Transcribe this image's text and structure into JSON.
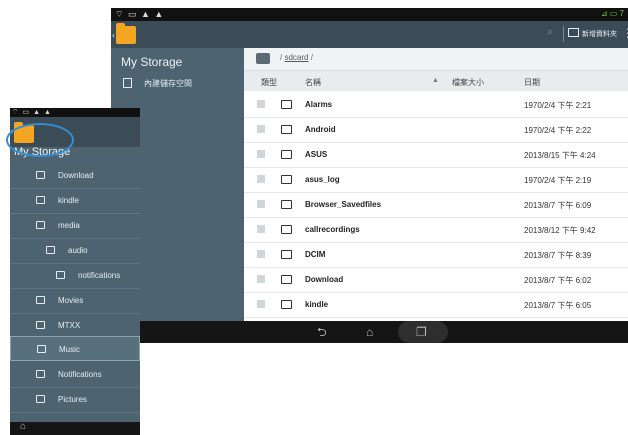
{
  "tablet": {
    "status_left": "⌔ ▭ ▲ ▲",
    "status_right": "⊿ ▭ 7",
    "actionbar": {
      "new_folder_label": "新增資料夾",
      "menu_icon": "⋮"
    },
    "sidebar": {
      "title": "My Storage",
      "items": [
        {
          "label": "內建儲存空間"
        }
      ]
    },
    "breadcrumb": {
      "root": "/",
      "path": "sdcard",
      "trail": "/"
    },
    "table": {
      "headers": {
        "type": "類型",
        "name": "名稱",
        "sort": "▲",
        "size": "檔案大小",
        "date": "日期"
      },
      "rows": [
        {
          "name": "Alarms",
          "date": "1970/2/4 下午 2:21"
        },
        {
          "name": "Android",
          "date": "1970/2/4 下午 2:22"
        },
        {
          "name": "ASUS",
          "date": "2013/8/15 下午 4:24"
        },
        {
          "name": "asus_log",
          "date": "1970/2/4 下午 2:19"
        },
        {
          "name": "Browser_Savedfiles",
          "date": "2013/8/7 下午 6:09"
        },
        {
          "name": "callrecordings",
          "date": "2013/8/12 下午 9:42"
        },
        {
          "name": "DCIM",
          "date": "2013/8/7 下午 8:39"
        },
        {
          "name": "Download",
          "date": "2013/8/7 下午 6:02"
        },
        {
          "name": "kindle",
          "date": "2013/8/7 下午 6:05"
        }
      ]
    },
    "nav": {
      "back": "⮌",
      "home": "⌂",
      "recent": "❐"
    }
  },
  "phone": {
    "status_left": "⌔ ▭ ▲ ▲",
    "title": "My Storage",
    "items": [
      {
        "label": "Download"
      },
      {
        "label": "kindle"
      },
      {
        "label": "media"
      },
      {
        "label": "audio"
      },
      {
        "label": "notifications"
      },
      {
        "label": "Movies"
      },
      {
        "label": "MTXX"
      },
      {
        "label": "Music"
      },
      {
        "label": "Notifications"
      },
      {
        "label": "Pictures"
      }
    ],
    "nav_home": "⌂"
  }
}
